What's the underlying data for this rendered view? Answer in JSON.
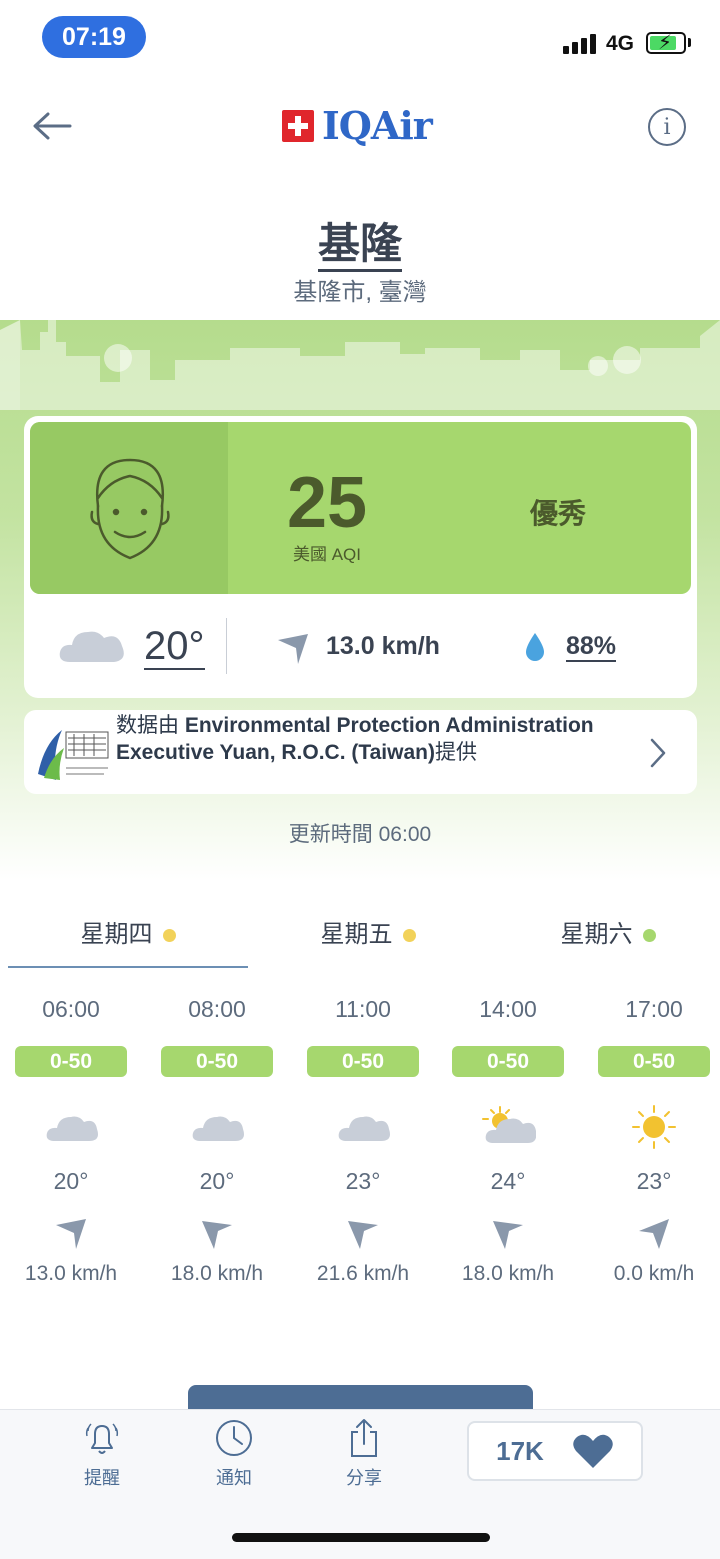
{
  "status_bar": {
    "time": "07:19",
    "network": "4G"
  },
  "header": {
    "brand": "IQAir"
  },
  "location": {
    "city": "基隆",
    "region": "基隆市, 臺灣"
  },
  "aqi": {
    "value": "25",
    "label": "美國 AQI",
    "status": "優秀",
    "color": "#a6d76e"
  },
  "weather": {
    "temp": "20°",
    "wind": "13.0 km/h",
    "humidity": "88%"
  },
  "provider": {
    "prefix": "数据由 ",
    "name": "Environmental Protection Administration Executive Yuan, R.O.C. (Taiwan)",
    "suffix": "提供"
  },
  "updated": "更新時間 06:00",
  "days": [
    {
      "label": "星期四",
      "dot": "#f2d25a"
    },
    {
      "label": "星期五",
      "dot": "#f2d25a"
    },
    {
      "label": "星期六",
      "dot": "#a6d76e"
    }
  ],
  "hourly": [
    {
      "hour": "06:00",
      "aqi": "0-50",
      "icon": "cloud-icon",
      "temp": "20°",
      "wind": "13.0 km/h"
    },
    {
      "hour": "08:00",
      "aqi": "0-50",
      "icon": "cloud-icon",
      "temp": "20°",
      "wind": "18.0 km/h"
    },
    {
      "hour": "11:00",
      "aqi": "0-50",
      "icon": "cloud-icon",
      "temp": "23°",
      "wind": "21.6 km/h"
    },
    {
      "hour": "14:00",
      "aqi": "0-50",
      "icon": "partly-sunny-icon",
      "temp": "24°",
      "wind": "18.0 km/h"
    },
    {
      "hour": "17:00",
      "aqi": "0-50",
      "icon": "sun-icon",
      "temp": "23°",
      "wind": "0.0 km/h"
    }
  ],
  "bottom_nav": {
    "alert": "提醒",
    "notify": "通知",
    "share": "分享",
    "likes": "17K"
  }
}
